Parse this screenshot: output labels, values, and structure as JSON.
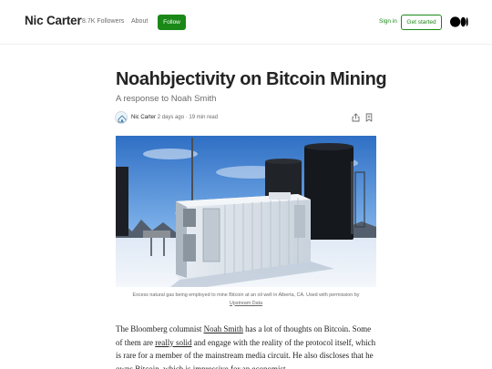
{
  "header": {
    "publication": "Nic Carter",
    "followers": "8.7K Followers",
    "about": "About",
    "follow": "Follow",
    "sign_in": "Sign in",
    "get_started": "Get started"
  },
  "article": {
    "title": "Noahbjectivity on Bitcoin Mining",
    "subtitle": "A response to Noah Smith",
    "author": "Nic Carter",
    "published": "2 days ago",
    "separator": "·",
    "read_time": "19 min read",
    "caption_text": "Excess natural gas being employed to mine Bitcoin at an oil well in Alberta, CA. Used with permission by",
    "caption_link": "Upstream Data",
    "body": {
      "p1_a": "The Bloomberg columnist ",
      "p1_link1": "Noah Smith",
      "p1_b": " has a lot of thoughts on Bitcoin. Some of them are ",
      "p1_link2": "really solid",
      "p1_c": " and engage with the reality of the protocol itself, which is rare for a member of the mainstream media circuit. He also discloses that he owns Bitcoin, which is impressive for an economist"
    }
  },
  "icons": {
    "share": "share-icon",
    "bookmark": "bookmark-icon",
    "logo": "medium-logo-icon"
  },
  "colors": {
    "brand_green": "#1a8917",
    "text": "#242424",
    "muted": "#6b6b6b"
  }
}
